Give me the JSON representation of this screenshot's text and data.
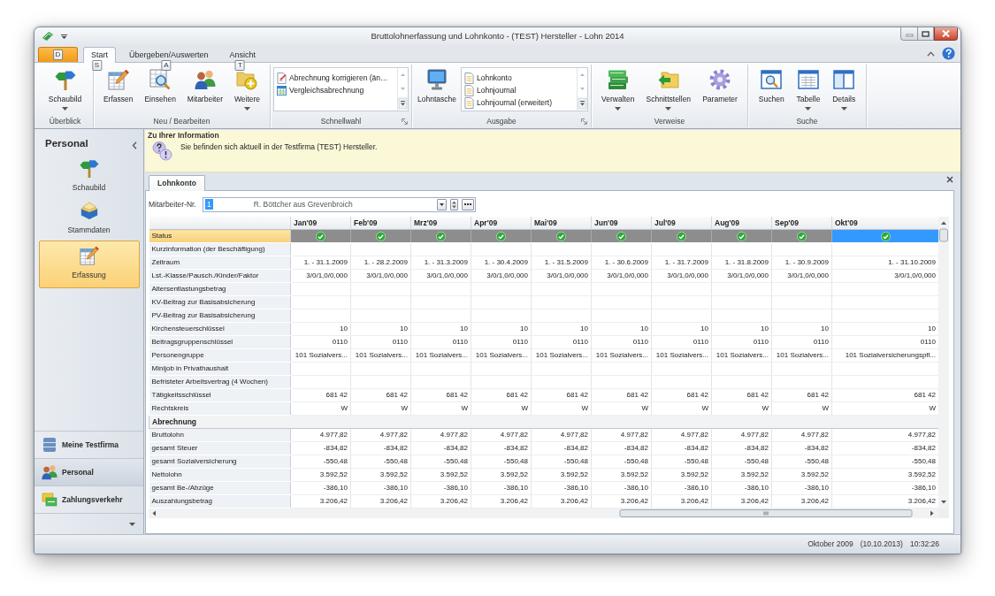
{
  "window": {
    "title": "Bruttolohnerfassung und Lohnkonto - (TEST) Hersteller - Lohn 2014"
  },
  "ribbon": {
    "app_key_tip": "D",
    "tabs": [
      {
        "label": "Start",
        "key_tip": "S",
        "selected": true
      },
      {
        "label": "Übergeben/Auswerten",
        "key_tip": "A",
        "selected": false
      },
      {
        "label": "Ansicht",
        "key_tip": "T",
        "selected": false
      }
    ],
    "groups": [
      {
        "label": "Überblick",
        "dialog_launcher": false,
        "buttons": [
          {
            "label": "Schaubild",
            "dropdown": true
          }
        ]
      },
      {
        "label": "Neu / Bearbeiten",
        "dialog_launcher": false,
        "buttons": [
          {
            "label": "Erfassen",
            "dropdown": false
          },
          {
            "label": "Einsehen",
            "dropdown": false
          },
          {
            "label": "Mitarbeiter",
            "dropdown": false
          },
          {
            "label": "Weitere",
            "dropdown": true
          }
        ]
      },
      {
        "label": "Schnellwahl",
        "dialog_launcher": true,
        "gallery": [
          "Abrechnung korrigieren (än…",
          "Vergleichsabrechnung"
        ]
      },
      {
        "label": "Ausgabe",
        "dialog_launcher": true,
        "buttons": [
          {
            "label": "Lohntasche",
            "dropdown": false
          }
        ],
        "gallery": [
          "Lohnkonto",
          "Lohnjournal",
          "Lohnjournal (erweitert)"
        ]
      },
      {
        "label": "Verweise",
        "dialog_launcher": false,
        "buttons": [
          {
            "label": "Verwalten",
            "dropdown": true
          },
          {
            "label": "Schnittstellen",
            "dropdown": true
          },
          {
            "label": "Parameter",
            "dropdown": false
          }
        ]
      },
      {
        "label": "Suche",
        "dialog_launcher": false,
        "buttons": [
          {
            "label": "Suchen",
            "dropdown": false
          },
          {
            "label": "Tabelle",
            "dropdown": true
          },
          {
            "label": "Details",
            "dropdown": true
          }
        ]
      }
    ]
  },
  "navigation": {
    "title": "Personal",
    "items": [
      {
        "label": "Schaubild",
        "selected": false
      },
      {
        "label": "Stammdaten",
        "selected": false
      },
      {
        "label": "Erfassung",
        "selected": true
      }
    ],
    "sections": [
      {
        "label": "Meine Testfirma",
        "selected": false
      },
      {
        "label": "Personal",
        "selected": true
      },
      {
        "label": "Zahlungsverkehr",
        "selected": false
      }
    ]
  },
  "info_bar": {
    "title": "Zu Ihrer Information",
    "message": "Sie befinden sich aktuell in der Testfirma (TEST) Hersteller."
  },
  "document_tabs": [
    {
      "label": "Lohnkonto",
      "selected": true
    }
  ],
  "employee": {
    "label": "Mitarbeiter-Nr.",
    "value": "1",
    "value_selected": true,
    "name": "R. Böttcher aus Grevenbroich"
  },
  "grid": {
    "columns": [
      {
        "label": "Jan'09",
        "selected": false
      },
      {
        "label": "Feb'09",
        "selected": false
      },
      {
        "label": "Mrz'09",
        "selected": false
      },
      {
        "label": "Apr'09",
        "selected": false
      },
      {
        "label": "Mai'09",
        "selected": false
      },
      {
        "label": "Jun'09",
        "selected": false
      },
      {
        "label": "Jul'09",
        "selected": false
      },
      {
        "label": "Aug'09",
        "selected": false
      },
      {
        "label": "Sep'09",
        "selected": false
      },
      {
        "label": "Okt'09",
        "selected": true
      }
    ],
    "rows": [
      {
        "kind": "status",
        "label": "Status",
        "selected": true,
        "cells": [
          {
            "done": true
          },
          {
            "done": true
          },
          {
            "done": true
          },
          {
            "done": true
          },
          {
            "done": true
          },
          {
            "done": true
          },
          {
            "done": true
          },
          {
            "done": true
          },
          {
            "done": true
          },
          {
            "done": true
          }
        ]
      },
      {
        "kind": "data",
        "label": "Kurzinformation (der Beschäftigung)",
        "selected": false
      },
      {
        "kind": "data",
        "label": "Zeitraum",
        "selected": false,
        "cells": [
          "1. - 31.1.2009",
          "1. - 28.2.2009",
          "1. - 31.3.2009",
          "1. - 30.4.2009",
          "1. - 31.5.2009",
          "1. - 30.6.2009",
          "1. - 31.7.2009",
          "1. - 31.8.2009",
          "1. - 30.9.2009",
          "1. - 31.10.2009"
        ]
      },
      {
        "kind": "data",
        "label": "Lst.-Klasse/Pausch./Kinder/Faktor",
        "selected": false,
        "cells": [
          "3/0/1,0/0,000",
          "3/0/1,0/0,000",
          "3/0/1,0/0,000",
          "3/0/1,0/0,000",
          "3/0/1,0/0,000",
          "3/0/1,0/0,000",
          "3/0/1,0/0,000",
          "3/0/1,0/0,000",
          "3/0/1,0/0,000",
          "3/0/1,0/0,000"
        ]
      },
      {
        "kind": "data",
        "label": "Altersentlastungsbetrag",
        "selected": false
      },
      {
        "kind": "data",
        "label": "KV-Beitrag zur Basisabsicherung",
        "selected": false
      },
      {
        "kind": "data",
        "label": "PV-Beitrag zur Basisabsicherung",
        "selected": false
      },
      {
        "kind": "data",
        "label": "Kirchensteuerschlüssel",
        "selected": false,
        "cells": [
          "10",
          "10",
          "10",
          "10",
          "10",
          "10",
          "10",
          "10",
          "10",
          "10"
        ]
      },
      {
        "kind": "data",
        "label": "Beitragsgruppenschlüssel",
        "selected": false,
        "cells": [
          "0110",
          "0110",
          "0110",
          "0110",
          "0110",
          "0110",
          "0110",
          "0110",
          "0110",
          "0110"
        ]
      },
      {
        "kind": "data",
        "label": "Personengruppe",
        "selected": false,
        "cells": [
          "101 Sozialvers...",
          "101 Sozialvers...",
          "101 Sozialvers...",
          "101 Sozialvers...",
          "101 Sozialvers...",
          "101 Sozialvers...",
          "101 Sozialvers...",
          "101 Sozialvers...",
          "101 Sozialvers...",
          "101 Sozialversicherungspfl..."
        ]
      },
      {
        "kind": "data",
        "label": "Minijob in Privathaushalt",
        "selected": false
      },
      {
        "kind": "data",
        "label": "Befristeter Arbeitsvertrag (4 Wochen)",
        "selected": false
      },
      {
        "kind": "data",
        "label": "Tätigkeitsschlüssel",
        "selected": false,
        "cells": [
          "681 42",
          "681 42",
          "681 42",
          "681 42",
          "681 42",
          "681 42",
          "681 42",
          "681 42",
          "681 42",
          "681 42"
        ]
      },
      {
        "kind": "data",
        "label": "Rechtskreis",
        "selected": false,
        "cells": [
          "W",
          "W",
          "W",
          "W",
          "W",
          "W",
          "W",
          "W",
          "W",
          "W"
        ]
      },
      {
        "kind": "section",
        "label": "Abrechnung",
        "selected": false
      },
      {
        "kind": "data",
        "label": "Bruttolohn",
        "selected": false,
        "cells": [
          "4.977,82",
          "4.977,82",
          "4.977,82",
          "4.977,82",
          "4.977,82",
          "4.977,82",
          "4.977,82",
          "4.977,82",
          "4.977,82",
          "4.977,82"
        ]
      },
      {
        "kind": "data",
        "label": "gesamt Steuer",
        "selected": false,
        "cells": [
          "-834,82",
          "-834,82",
          "-834,82",
          "-834,82",
          "-834,82",
          "-834,82",
          "-834,82",
          "-834,82",
          "-834,82",
          "-834,82"
        ]
      },
      {
        "kind": "data",
        "label": "gesamt Sozialversicherung",
        "selected": false,
        "cells": [
          "-550,48",
          "-550,48",
          "-550,48",
          "-550,48",
          "-550,48",
          "-550,48",
          "-550,48",
          "-550,48",
          "-550,48",
          "-550,48"
        ]
      },
      {
        "kind": "data",
        "label": "Nettolohn",
        "selected": false,
        "cells": [
          "3.592,52",
          "3.592,52",
          "3.592,52",
          "3.592,52",
          "3.592,52",
          "3.592,52",
          "3.592,52",
          "3.592,52",
          "3.592,52",
          "3.592,52"
        ]
      },
      {
        "kind": "data",
        "label": "gesamt Be-/Abzüge",
        "selected": false,
        "cells": [
          "-386,10",
          "-386,10",
          "-386,10",
          "-386,10",
          "-386,10",
          "-386,10",
          "-386,10",
          "-386,10",
          "-386,10",
          "-386,10"
        ]
      },
      {
        "kind": "data",
        "label": "Auszahlungsbetrag",
        "selected": false,
        "cells": [
          "3.206,42",
          "3.206,42",
          "3.206,42",
          "3.206,42",
          "3.206,42",
          "3.206,42",
          "3.206,42",
          "3.206,42",
          "3.206,42",
          "3.206,42"
        ]
      }
    ]
  },
  "status_bar": [
    "Oktober 2009",
    "(10.10.2013)",
    "10:32:26"
  ]
}
